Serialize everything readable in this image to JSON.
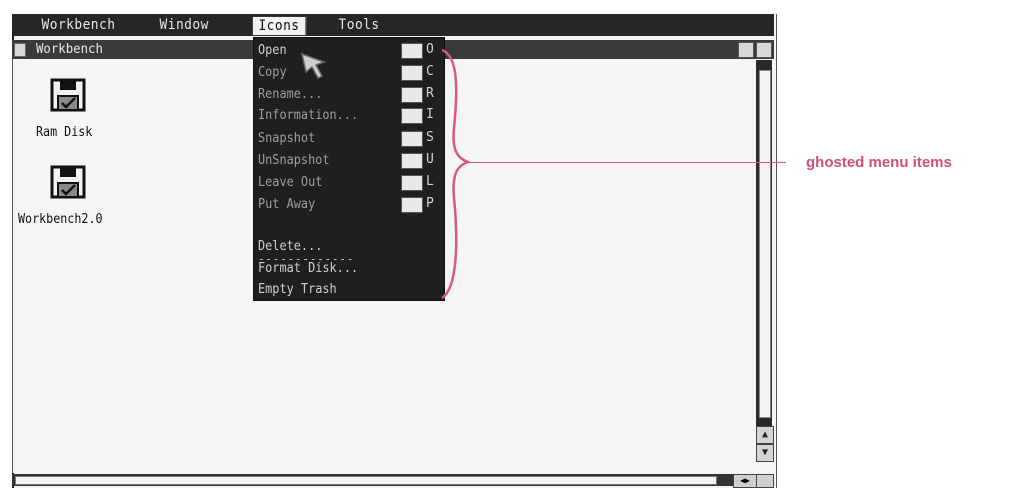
{
  "menubar": {
    "items": [
      "Workbench",
      "Window",
      "Icons",
      "Tools"
    ]
  },
  "window": {
    "title": "Workbench"
  },
  "desktop_icons": [
    {
      "label": "Ram Disk",
      "icon": "floppy-disk-icon"
    },
    {
      "label": "Workbench2.0",
      "icon": "floppy-disk-icon"
    }
  ],
  "icons_menu": {
    "items": [
      {
        "label": "Open",
        "shortcut": "O",
        "ghosted": false
      },
      {
        "label": "Copy",
        "shortcut": "C",
        "ghosted": true
      },
      {
        "label": "Rename...",
        "shortcut": "R",
        "ghosted": true
      },
      {
        "label": "Information...",
        "shortcut": "I",
        "ghosted": true
      },
      {
        "label": "Snapshot",
        "shortcut": "S",
        "ghosted": true
      },
      {
        "label": "UnSnapshot",
        "shortcut": "U",
        "ghosted": true
      },
      {
        "label": "Leave Out",
        "shortcut": "L",
        "ghosted": true
      },
      {
        "label": "Put Away",
        "shortcut": "P",
        "ghosted": true
      }
    ],
    "separator": "-------------",
    "bottom_items": [
      {
        "label": "Delete..."
      },
      {
        "label": "Format Disk..."
      },
      {
        "label": "Empty Trash"
      }
    ]
  },
  "annotation": {
    "text": "ghosted menu items",
    "color": "#d64d76"
  }
}
